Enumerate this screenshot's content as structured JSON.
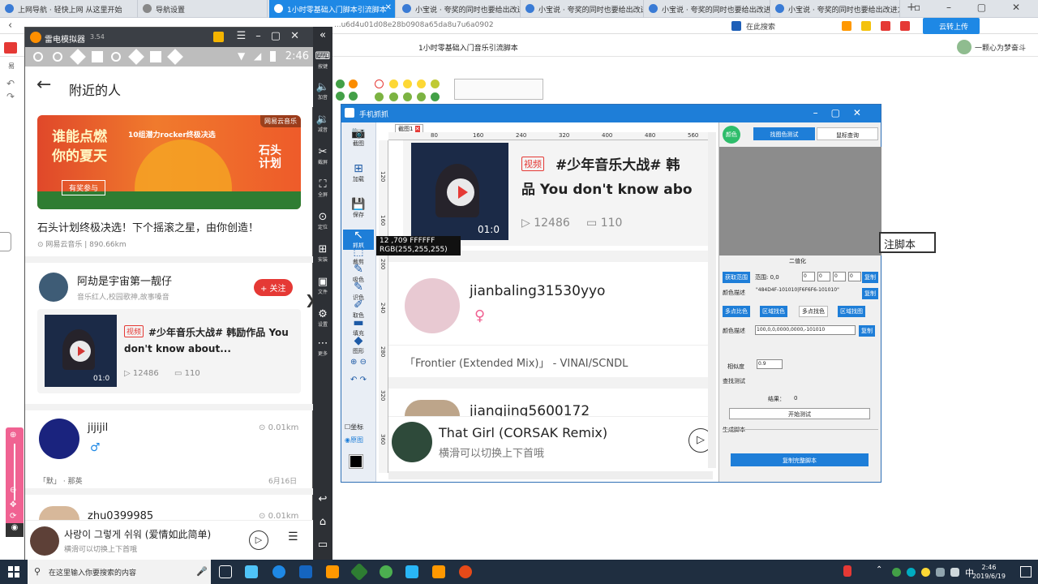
{
  "browser": {
    "tabs": [
      {
        "label": "上网导航 · 轻快上网 从这里开始",
        "active": false
      },
      {
        "label": "导航设置",
        "active": false
      },
      {
        "label": "1小时零基础入门脚本引流脚本",
        "active": true
      },
      {
        "label": "小宝说 · 夸奖的同时也要给出改进方向",
        "active": false
      },
      {
        "label": "小宝说 · 夸奖的同时也要给出改进方向",
        "active": false
      },
      {
        "label": "小宝说 · 夸奖的同时也要给出改进方向",
        "active": false
      },
      {
        "label": "小宝说 · 夸奖的同时也要给出改进方向",
        "active": false
      }
    ],
    "url": "...u6d4u01d08e28b0908a65da8u7u6a0902",
    "addr_right": "在此搜索",
    "cloud_button": "云转上传",
    "page_title": "1小时零基础入门音乐引流脚本",
    "user": "一颗心为梦奋斗"
  },
  "emulator": {
    "title": "雷电模拟器",
    "version": "3.54",
    "time": "2:46",
    "app_title": "附近的人",
    "banner": {
      "line1": "谁能点燃",
      "line2": "你的夏天",
      "subtitle": "10组潜力rocker终极决选",
      "tag": "网易云音乐",
      "cta": "有奖参与",
      "right_text": "石头计划"
    },
    "post1": {
      "title": "石头计划终极决选！下个摇滚之星，由你创造！",
      "meta": "网易云音乐 | 890.66km"
    },
    "user1": {
      "name": "阿劫是宇宙第一靓仔",
      "desc": "音乐红人,校园歌神,故事嗓音",
      "follow": "+ 关注"
    },
    "video1": {
      "badge": "视频",
      "title": "#少年音乐大战# 韩励作品 You don't know about...",
      "duration": "01:0",
      "plays": "12486",
      "comments": "110"
    },
    "user2": {
      "name": "jijijil",
      "gender": "♂",
      "distance": "0.01km",
      "song": "「默」 · 那英",
      "date": "6月16日"
    },
    "user3": {
      "name": "zhu0399985",
      "distance": "0.01km"
    },
    "miniplayer": {
      "song": "사랑이 그렇게 쉬워 (爱情如此简单)",
      "hint": "横滑可以切换上下首哦"
    },
    "side_labels": [
      "按键",
      "加音",
      "减音",
      "截屏",
      "全屏",
      "定位",
      "安装",
      "文件",
      "设置",
      "更多"
    ]
  },
  "editor": {
    "title": "手机抓抓",
    "tab": "截图1",
    "tools": [
      "截图",
      "加载",
      "保存",
      "抓抓",
      "裁剪",
      "吸色",
      "识色",
      "取色",
      "填充",
      "图形"
    ],
    "ruler_h": [
      "80",
      "160",
      "240",
      "320",
      "400",
      "480",
      "560"
    ],
    "ruler_v": [
      "120",
      "160",
      "200",
      "240",
      "280",
      "320",
      "360",
      "400"
    ],
    "tooltip_line1": "12 ,709  FFFFFF",
    "tooltip_line2": "RGB(255,255,255)",
    "bottom_check1": "坐标",
    "bottom_check2": "原图",
    "shot": {
      "badge": "视频",
      "title_line1": "#少年音乐大战# 韩",
      "title_line2": "品 You don't know abo",
      "duration": "01:0",
      "plays": "12486",
      "comments": "110",
      "user_a": "jianbaling31530yyo",
      "user_a_song": "「Frontier (Extended Mix)」 - VINAI/SCNDL",
      "user_b": "jiangjing5600172",
      "player_song": "That Girl (CORSAK Remix)",
      "player_hint": "横滑可以切换上下首哦"
    },
    "right": {
      "app_label": "颜色",
      "tab1": "找图色测试",
      "tab2": "鼠标查询",
      "section": "二值化",
      "btn_range": "获取范围",
      "range_label": "范围: 0,0",
      "inputs_small": [
        "0",
        "0",
        "0",
        "0"
      ],
      "copy": "复制",
      "color_desc_label": "颜色描述",
      "color_desc_value": "\"484D4F-101010|F6F6F6-101010\"",
      "tabs2": [
        "多点比色",
        "区域找色",
        "多点找色",
        "区域找图"
      ],
      "color_desc2": "100,0,0,0000,0000,-101010",
      "similarity_label": "相似度",
      "similarity": "0.9",
      "find_test": "查找测试",
      "result_label": "结果：",
      "result": "0",
      "start_test": "开始测试",
      "gen_script": "生成脚本",
      "copy_script": "复制完整脚本"
    }
  },
  "page_right_script": "注脚本",
  "taskbar": {
    "search_placeholder": "在这里输入你要搜索的内容",
    "time": "2:46",
    "date": "2019/6/19"
  }
}
